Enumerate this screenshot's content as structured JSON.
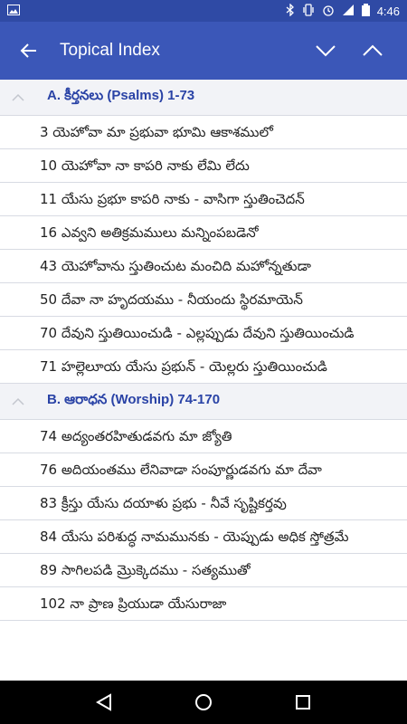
{
  "status": {
    "time": "4:46"
  },
  "appbar": {
    "title": "Topical Index"
  },
  "sections": [
    {
      "label": "A. కీర్తనలు (Psalms) 1-73",
      "items": [
        "3 యెహోవా మా ప్రభువా భూమి ఆకాశములో",
        "10 యెహోవా నా కాపరి నాకు లేమి లేదు",
        "11 యేసు ప్రభూ కాపరి నాకు - వాసిగా స్తుతించెదన్",
        "16 ఎవ్వని అతిక్రమములు మన్నింపబడెనో",
        "43 యెహోవాను స్తుతించుట మంచిది మహోన్నతుడా",
        "50 దేవా నా హృదయము - నీయందు స్థిరమాయెన్",
        "70 దేవుని స్తుతియించుడి - ఎల్లప్పుడు దేవుని స్తుతియించుడి",
        "71 హల్లెలూయ యేసు ప్రభున్ - యెల్లరు స్తుతియించుడి"
      ]
    },
    {
      "label": "B. ఆరాధన (Worship) 74-170",
      "items": [
        "74 అద్యంతరహితుడవగు మా జ్యోతి",
        "76 అదియంతము లేనివాడా సంపూర్ణుడవగు మా దేవా",
        "83 క్రీస్తు యేసు దయాళు ప్రభు - నీవే సృష్టికర్తవు",
        "84 యేసు పరిశుద్ధ నామమునకు - యెప్పుడు అధిక స్తోత్రమే",
        "89 సాగిలపడి మ్రొక్కెదము - సత్యముతో",
        "102 నా ప్రాణ ప్రియుడా యేసురాజా"
      ]
    }
  ],
  "colors": {
    "statusbar": "#2f4aa5",
    "appbar": "#3b57b8",
    "section_text": "#2a43a6"
  }
}
